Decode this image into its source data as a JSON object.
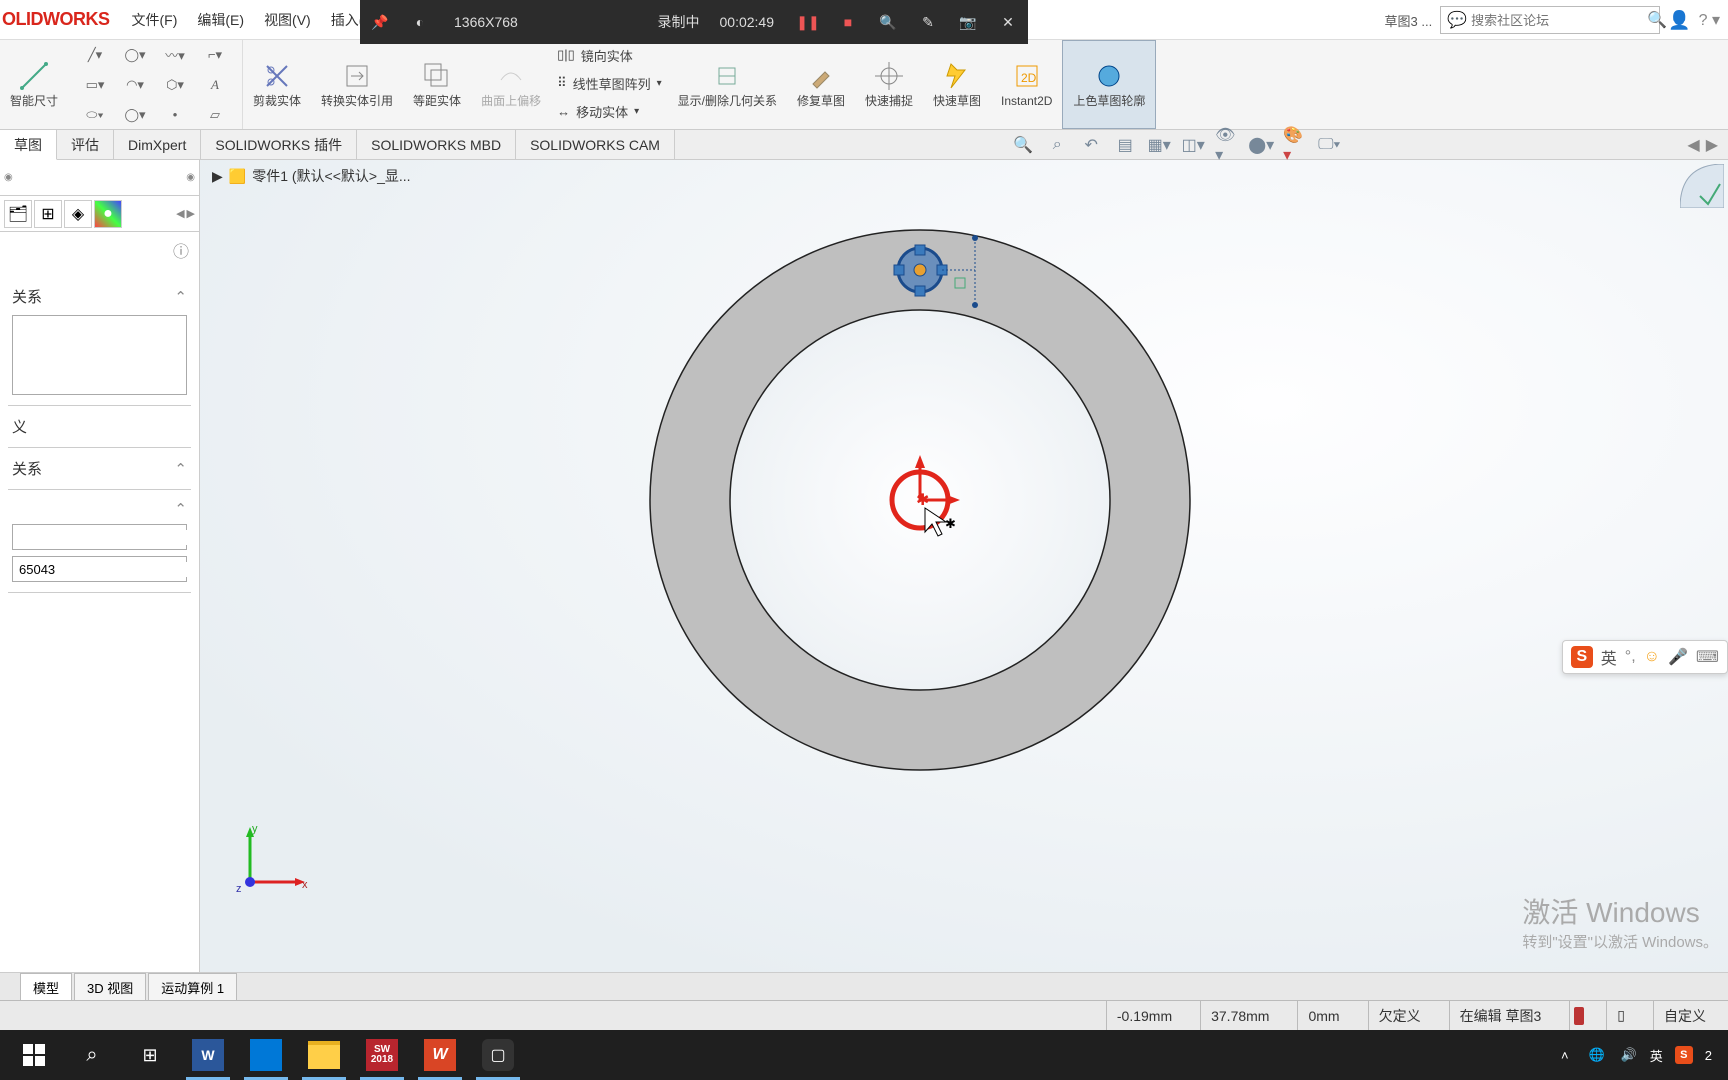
{
  "logo": "OLIDWORKS",
  "menu": {
    "file": "文件(F)",
    "edit": "编辑(E)",
    "view": "视图(V)",
    "insert": "插入(I)"
  },
  "recorder": {
    "resolution": "1366X768",
    "status": "录制中",
    "time": "00:02:49"
  },
  "header": {
    "doc_tab": "草图3 ...",
    "search_placeholder": "搜索社区论坛"
  },
  "ribbon": {
    "smart_dim": "智能尺寸",
    "trim": "剪裁实体",
    "convert": "转换实体引用",
    "offset": "等距实体",
    "surface_offset": "曲面上偏移",
    "mirror": "镜向实体",
    "linear_pattern": "线性草图阵列",
    "move": "移动实体",
    "display_rel": "显示/删除几何关系",
    "repair": "修复草图",
    "quick_snap": "快速捕捉",
    "rapid_sketch": "快速草图",
    "instant2d": "Instant2D",
    "shaded": "上色草图轮廓"
  },
  "tabs": {
    "sketch": "草图",
    "evaluate": "评估",
    "dimxpert": "DimXpert",
    "addins": "SOLIDWORKS 插件",
    "mbd": "SOLIDWORKS MBD",
    "cam": "SOLIDWORKS CAM"
  },
  "breadcrumb": {
    "part": "零件1  (默认<<默认>_显..."
  },
  "panel": {
    "relations": "关系",
    "definition": "义",
    "add_relations": "关系",
    "spin_value": "65043"
  },
  "triad_axes": {
    "x": "x",
    "y": "y",
    "z": "z"
  },
  "ime": {
    "lang": "英"
  },
  "watermark": {
    "title": "激活 Windows",
    "sub": "转到\"设置\"以激活 Windows。"
  },
  "bottom_tabs": {
    "model": "模型",
    "view3d": "3D 视图",
    "motion": "运动算例 1"
  },
  "status": {
    "x": "-0.19mm",
    "y": "37.78mm",
    "z": "0mm",
    "state": "欠定义",
    "edit": "在编辑 草图3",
    "custom": "自定义"
  },
  "tray": {
    "ime_mode": "英",
    "time_suffix": "2"
  }
}
